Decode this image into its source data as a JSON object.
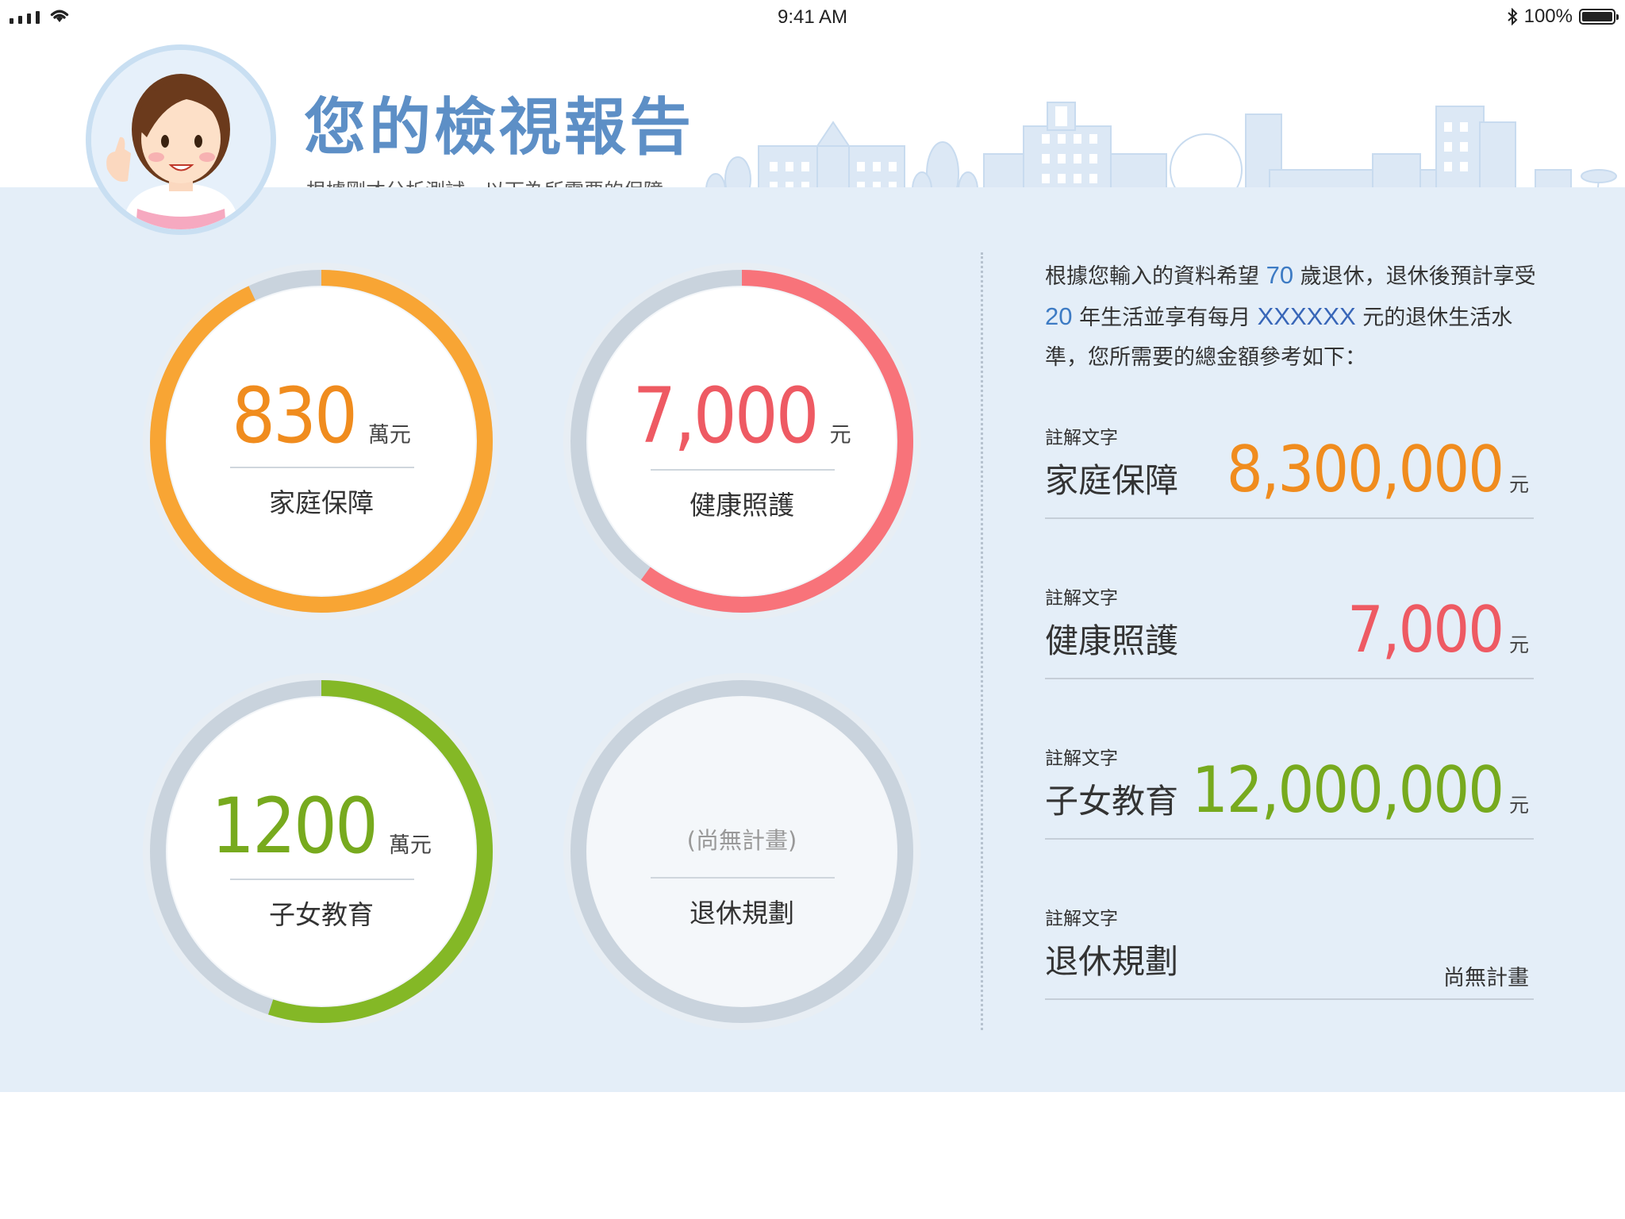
{
  "status_bar": {
    "time": "9:41 AM",
    "battery": "100%"
  },
  "header": {
    "title": "您的檢視報告",
    "subtitle": "根據剛才分析測試，以下為所需要的保障"
  },
  "colors": {
    "orange": "#f8a534",
    "orange_text": "#f08c1e",
    "red": "#f8737a",
    "red_text": "#ee5a63",
    "green": "#84b826",
    "green_text": "#77aa1e",
    "accent_blue": "#5d8fc6"
  },
  "rings": [
    {
      "value": "830",
      "unit": "萬元",
      "label": "家庭保障",
      "progress": 0.93
    },
    {
      "value": "7,000",
      "unit": "元",
      "label": "健康照護",
      "progress": 0.6
    },
    {
      "value": "1200",
      "unit": "萬元",
      "label": "子女教育",
      "progress": 0.55
    },
    {
      "no_plan_text": "(尚無計畫)",
      "label": "退休規劃",
      "progress": 0
    }
  ],
  "intro": {
    "p1": "根據您輸入的資料希望 ",
    "retire_age": "70",
    "p2": " 歲退休，退休後預計享受 ",
    "years": "20",
    "p3": " 年生活並享有每月 ",
    "monthly": "XXXXXX",
    "p4": " 元的退休生活水準，您所需要的總金額參考如下："
  },
  "summary": [
    {
      "note": "註解文字",
      "name": "家庭保障",
      "value": "8,300,000",
      "unit": "元"
    },
    {
      "note": "註解文字",
      "name": "健康照護",
      "value": "7,000",
      "unit": "元"
    },
    {
      "note": "註解文字",
      "name": "子女教育",
      "value": "12,000,000",
      "unit": "元"
    },
    {
      "note": "註解文字",
      "name": "退休規劃",
      "text": "尚無計畫"
    }
  ]
}
